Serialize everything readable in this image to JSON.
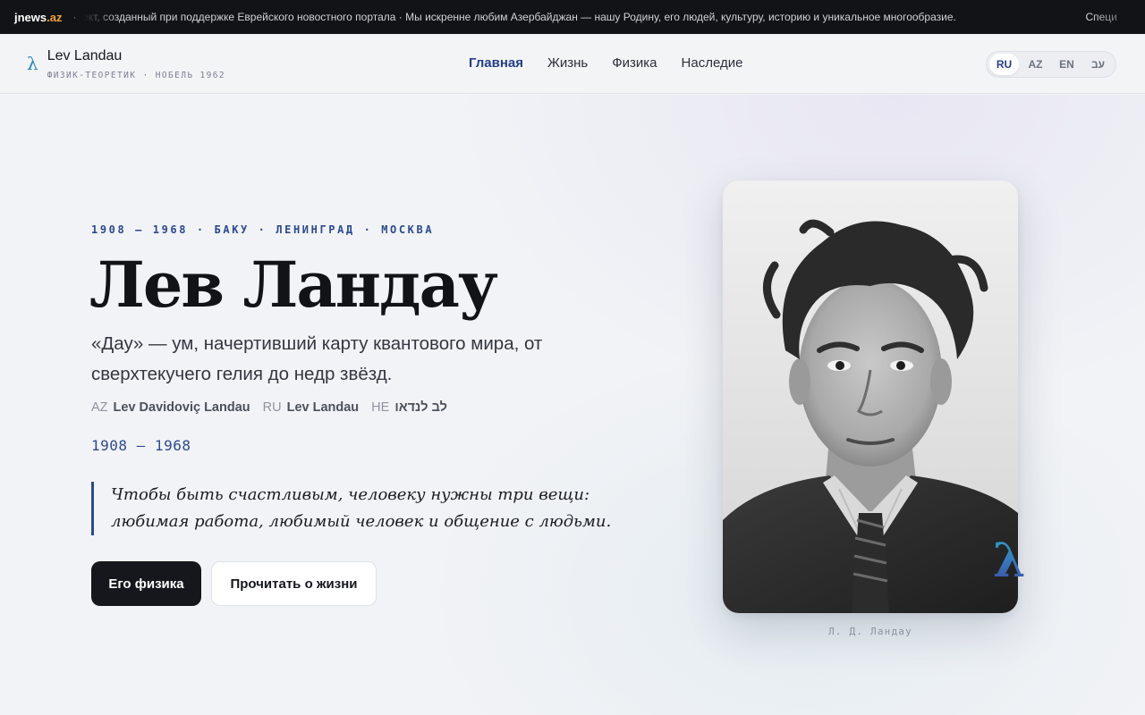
{
  "ticker": {
    "brand_main": "jnews",
    "brand_tld": ".az",
    "separator": "·",
    "message": "оект, созданный при поддержке Еврейского новостного портала · Мы искренне любим Азербайджан — нашу Родину, его людей, культуру, историю и уникальное многообразие.",
    "message_next": "Специ"
  },
  "header": {
    "logo_icon": "λ",
    "site_name": "Lev Landau",
    "tagline": "ФИЗИК-ТЕОРЕТИК · НОБЕЛЬ 1962",
    "nav": [
      {
        "label": "Главная",
        "active": true
      },
      {
        "label": "Жизнь",
        "active": false
      },
      {
        "label": "Физика",
        "active": false
      },
      {
        "label": "Наследие",
        "active": false
      }
    ],
    "languages": [
      {
        "label": "RU",
        "active": true
      },
      {
        "label": "AZ",
        "active": false
      },
      {
        "label": "EN",
        "active": false
      },
      {
        "label": "עב",
        "active": false
      }
    ]
  },
  "hero": {
    "eyebrow": "1908 — 1968 · БАКУ · ЛЕНИНГРАД · МОСКВА",
    "title": "Лев Ландау",
    "lead": "«Дау» — ум, начертивший карту квантового мира, от сверхтекучего гелия до недр звёзд.",
    "names": [
      {
        "code": "AZ",
        "value": "Lev Davidoviç Landau"
      },
      {
        "code": "RU",
        "value": "Lev Landau"
      },
      {
        "code": "HE",
        "value": "לב לנדאו"
      }
    ],
    "years": "1908 — 1968",
    "quote": "Чтобы быть счастливым, человеку нужны три вещи: любимая работа, любимый человек и общение с людьми.",
    "primary_button": "Его физика",
    "secondary_button": "Прочитать о жизни"
  },
  "portrait": {
    "badge": "λ",
    "caption": "Л. Д. Ландау"
  },
  "colors": {
    "accent": "#2d4a8f",
    "lambda": "#2a87b8",
    "ticker_bg": "#121316",
    "primary_button_bg": "#16171c"
  }
}
